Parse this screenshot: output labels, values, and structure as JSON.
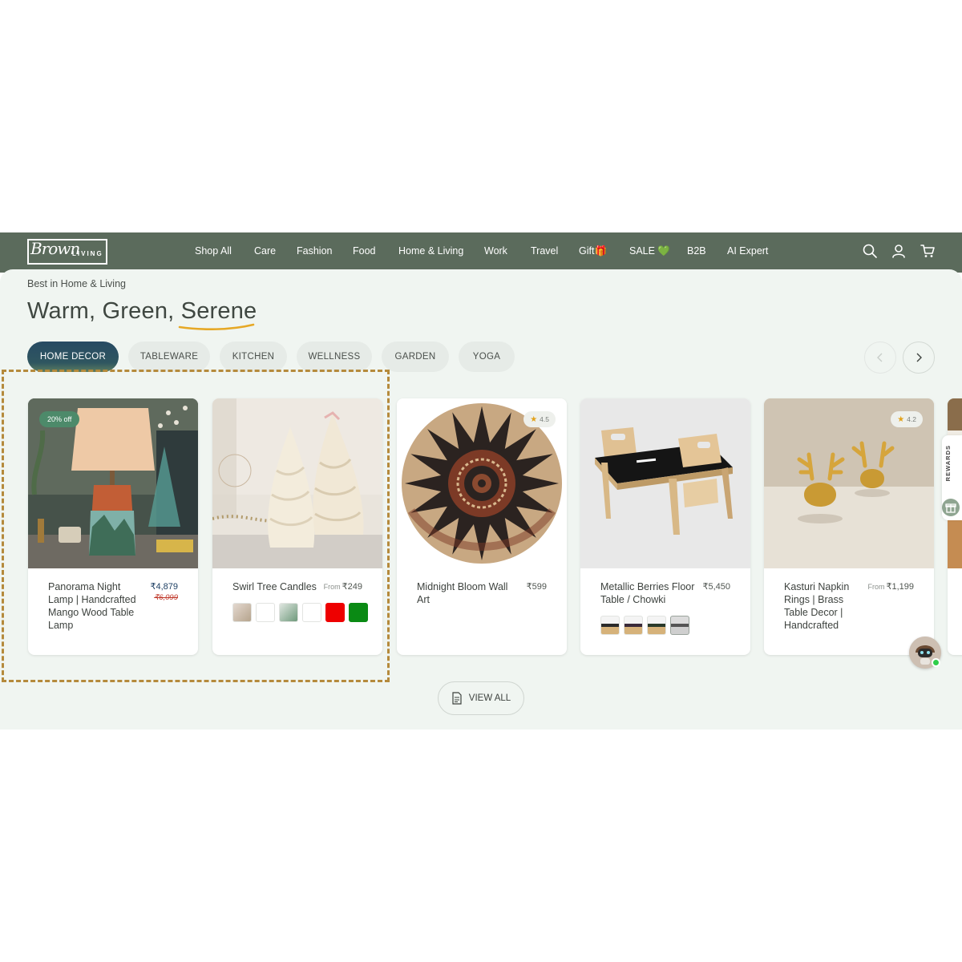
{
  "brand": {
    "script": "Brown",
    "caps": "LIVING"
  },
  "nav": [
    {
      "label": "Shop All"
    },
    {
      "label": "Care"
    },
    {
      "label": "Fashion"
    },
    {
      "label": "Food"
    },
    {
      "label": "Home & Living"
    },
    {
      "label": "Work"
    },
    {
      "label": "Travel"
    },
    {
      "label": "Gift🎁"
    },
    {
      "label": "SALE 💚"
    },
    {
      "label": "B2B"
    },
    {
      "label": "AI Expert"
    }
  ],
  "header_icons": [
    "search-icon",
    "user-icon",
    "cart-icon"
  ],
  "section": {
    "eyebrow": "Best in Home & Living",
    "title": "Warm, Green, Serene"
  },
  "tabs": [
    {
      "label": "HOME DECOR",
      "active": true
    },
    {
      "label": "TABLEWARE"
    },
    {
      "label": "KITCHEN"
    },
    {
      "label": "WELLNESS"
    },
    {
      "label": "GARDEN"
    },
    {
      "label": "YOGA"
    }
  ],
  "colors": {
    "header": "#5b6b5c",
    "panel": "#f0f5f1",
    "accent": "#274a63",
    "badge": "#4d8a6a",
    "dash": "#b58a3c"
  },
  "products": [
    {
      "name": "Panorama Night Lamp | Handcrafted Mango Wood Table Lamp",
      "price": "₹4,879",
      "old_price": "₹6,099",
      "badge": "20% off"
    },
    {
      "name": "Swirl Tree Candles",
      "from": "From",
      "price": "₹249"
    },
    {
      "name": "Midnight Bloom Wall Art",
      "price": "₹599",
      "rating": "4.5"
    },
    {
      "name": "Metallic Berries Floor Table / Chowki",
      "price": "₹5,450"
    },
    {
      "name": "Kasturi Napkin Rings | Brass Table Decor | Handcrafted",
      "from": "From",
      "price": "₹1,199",
      "rating": "4.2"
    }
  ],
  "view_all": "VIEW ALL",
  "rewards": "REWARDS"
}
